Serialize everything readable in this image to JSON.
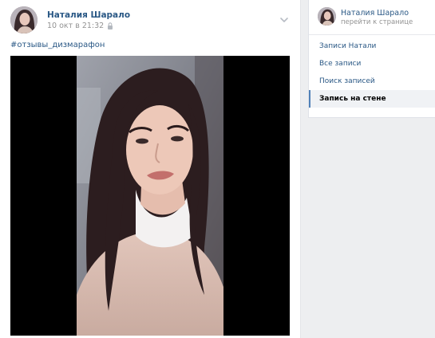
{
  "post": {
    "author": "Наталия Шарало",
    "date": "10 окт в 21:32",
    "hashtag": "#отзывы_дизмарафон",
    "privacy_icon": "lock-icon",
    "menu_icon": "chevron-down-icon"
  },
  "sidebar": {
    "name": "Наталия Шарало",
    "profile_link": "перейти к странице",
    "menu": [
      {
        "label": "Записи Натали"
      },
      {
        "label": "Все записи"
      },
      {
        "label": "Поиск записей"
      },
      {
        "label": "Запись на стене",
        "active": true
      }
    ]
  },
  "colors": {
    "link": "#2a5885",
    "muted": "#939393",
    "page_bg": "#edeef0",
    "active_marker": "#5181b8"
  }
}
